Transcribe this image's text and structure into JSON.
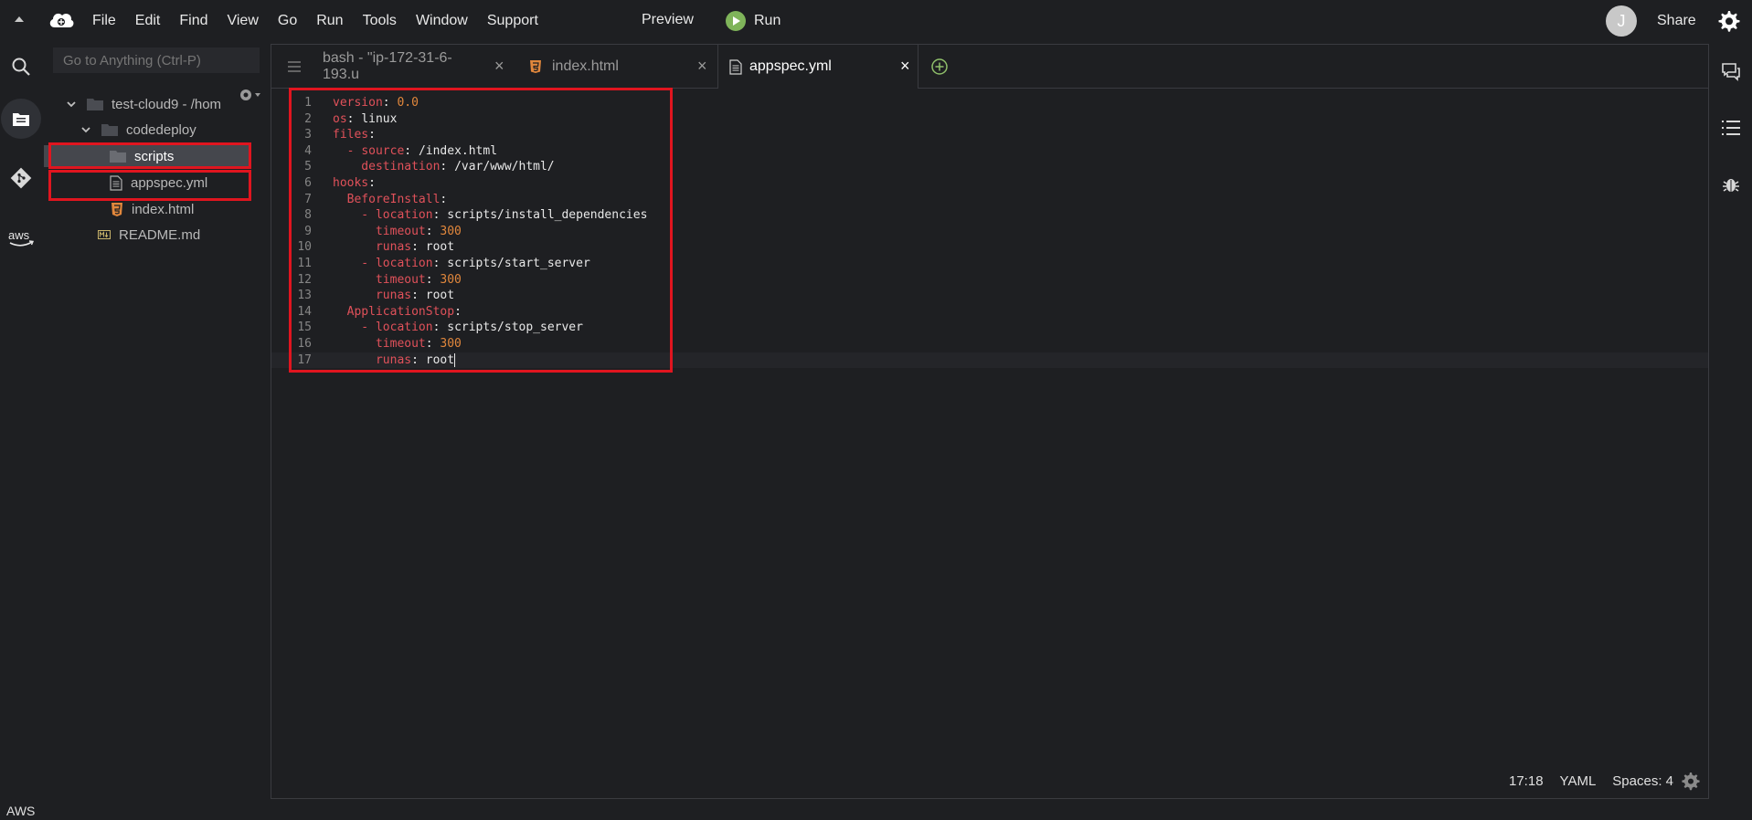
{
  "menu": {
    "items": [
      "File",
      "Edit",
      "Find",
      "View",
      "Go",
      "Run",
      "Tools",
      "Window",
      "Support"
    ],
    "preview": "Preview",
    "run": "Run",
    "avatar_letter": "J",
    "share": "Share"
  },
  "rail": {
    "bottom_label": "AWS",
    "aws_logo_text": "aws"
  },
  "tree": {
    "goto_placeholder": "Go to Anything (Ctrl-P)",
    "root": "test-cloud9 - /hom",
    "folder": "codedeploy",
    "items": {
      "scripts": "scripts",
      "appspec": "appspec.yml",
      "index": "index.html",
      "readme": "README.md"
    }
  },
  "tabs": {
    "bash": "bash - \"ip-172-31-6-193.u",
    "index": "index.html",
    "appspec": "appspec.yml"
  },
  "code": [
    [
      {
        "t": "version",
        "c": "k"
      },
      {
        "t": ": ",
        "c": "p"
      },
      {
        "t": "0.0",
        "c": "n"
      }
    ],
    [
      {
        "t": "os",
        "c": "k"
      },
      {
        "t": ": ",
        "c": "p"
      },
      {
        "t": "linux",
        "c": "v"
      }
    ],
    [
      {
        "t": "files",
        "c": "k"
      },
      {
        "t": ":",
        "c": "p"
      }
    ],
    [
      {
        "t": "  - ",
        "c": "k"
      },
      {
        "t": "source",
        "c": "k"
      },
      {
        "t": ": ",
        "c": "p"
      },
      {
        "t": "/index.html",
        "c": "v"
      }
    ],
    [
      {
        "t": "    destination",
        "c": "k"
      },
      {
        "t": ": ",
        "c": "p"
      },
      {
        "t": "/var/www/html/",
        "c": "v"
      }
    ],
    [
      {
        "t": "hooks",
        "c": "k"
      },
      {
        "t": ":",
        "c": "p"
      }
    ],
    [
      {
        "t": "  BeforeInstall",
        "c": "k"
      },
      {
        "t": ":",
        "c": "p"
      }
    ],
    [
      {
        "t": "    - ",
        "c": "k"
      },
      {
        "t": "location",
        "c": "k"
      },
      {
        "t": ": ",
        "c": "p"
      },
      {
        "t": "scripts/install_dependencies",
        "c": "v"
      }
    ],
    [
      {
        "t": "      timeout",
        "c": "k"
      },
      {
        "t": ": ",
        "c": "p"
      },
      {
        "t": "300",
        "c": "n"
      }
    ],
    [
      {
        "t": "      runas",
        "c": "k"
      },
      {
        "t": ": ",
        "c": "p"
      },
      {
        "t": "root",
        "c": "v"
      }
    ],
    [
      {
        "t": "    - ",
        "c": "k"
      },
      {
        "t": "location",
        "c": "k"
      },
      {
        "t": ": ",
        "c": "p"
      },
      {
        "t": "scripts/start_server",
        "c": "v"
      }
    ],
    [
      {
        "t": "      timeout",
        "c": "k"
      },
      {
        "t": ": ",
        "c": "p"
      },
      {
        "t": "300",
        "c": "n"
      }
    ],
    [
      {
        "t": "      runas",
        "c": "k"
      },
      {
        "t": ": ",
        "c": "p"
      },
      {
        "t": "root",
        "c": "v"
      }
    ],
    [
      {
        "t": "  ApplicationStop",
        "c": "k"
      },
      {
        "t": ":",
        "c": "p"
      }
    ],
    [
      {
        "t": "    - ",
        "c": "k"
      },
      {
        "t": "location",
        "c": "k"
      },
      {
        "t": ": ",
        "c": "p"
      },
      {
        "t": "scripts/stop_server",
        "c": "v"
      }
    ],
    [
      {
        "t": "      timeout",
        "c": "k"
      },
      {
        "t": ": ",
        "c": "p"
      },
      {
        "t": "300",
        "c": "n"
      }
    ],
    [
      {
        "t": "      runas",
        "c": "k"
      },
      {
        "t": ": ",
        "c": "p"
      },
      {
        "t": "root",
        "c": "v"
      }
    ]
  ],
  "current_line": 17,
  "status": {
    "cursor": "17:18",
    "mode": "YAML",
    "indent": "Spaces: 4"
  },
  "colors": {
    "highlight_box": "#e0151f",
    "key": "#e0515a",
    "number": "#e1873c",
    "run_green": "#7fb45a"
  }
}
